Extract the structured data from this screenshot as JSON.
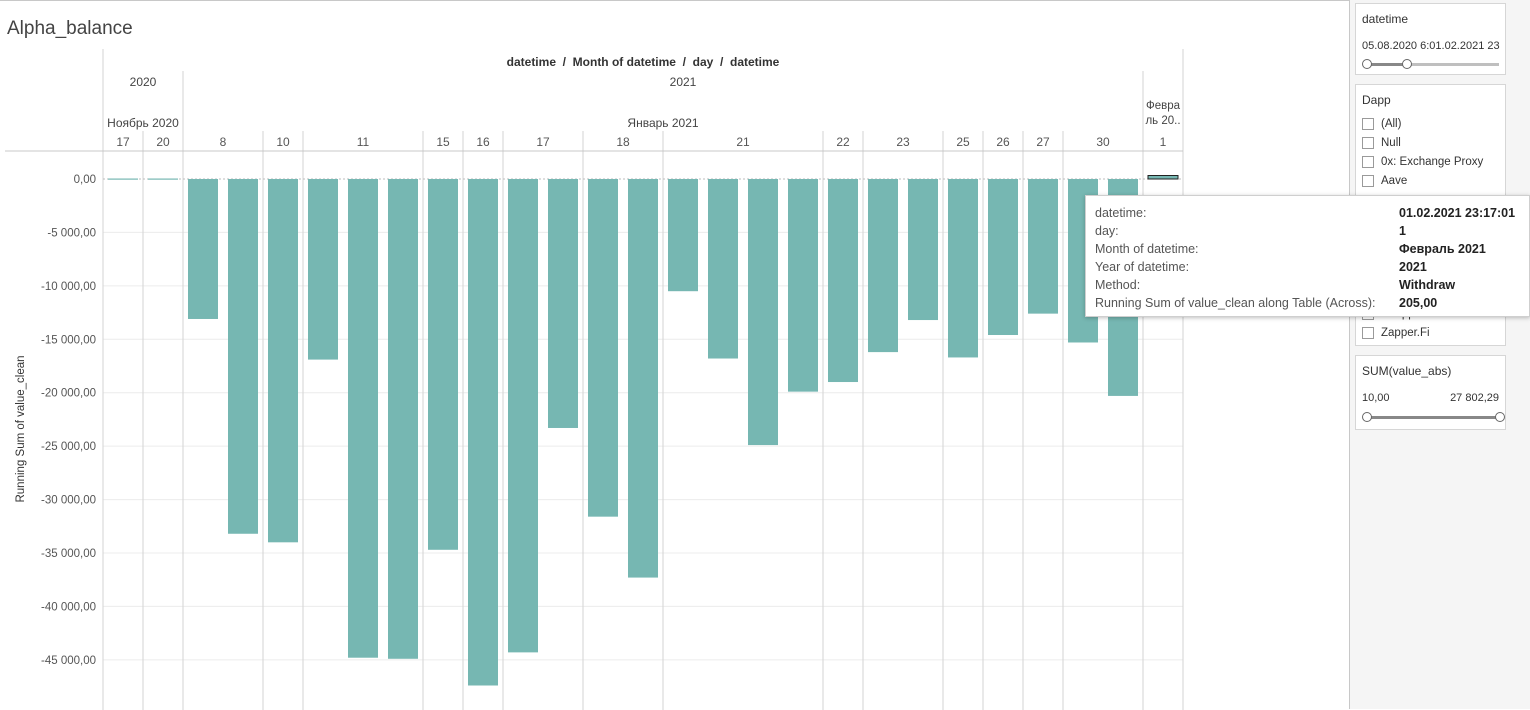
{
  "sheet": {
    "title": "Alpha_balance",
    "column_header": "datetime  /  Month of datetime  /  day  /  datetime",
    "years": [
      "2020",
      "2021"
    ],
    "months": [
      "Ноябрь 2020",
      "Январь 2021",
      "Февра ль 20.."
    ],
    "days": [
      "17",
      "20",
      "8",
      "10",
      "11",
      "15",
      "16",
      "17",
      "18",
      "21",
      "22",
      "23",
      "25",
      "26",
      "27",
      "30",
      "1"
    ],
    "y_axis_label": "Running Sum of value_clean"
  },
  "chart_data": {
    "type": "bar",
    "ylabel": "Running Sum of value_clean",
    "ylim": [
      -49000,
      2000
    ],
    "y_ticks": [
      0,
      -5000,
      -10000,
      -15000,
      -20000,
      -25000,
      -30000,
      -35000,
      -40000,
      -45000
    ],
    "y_tick_labels": [
      "0,00",
      "-5 000,00",
      "-10 000,00",
      "-15 000,00",
      "-20 000,00",
      "-25 000,00",
      "-30 000,00",
      "-35 000,00",
      "-40 000,00",
      "-45 000,00"
    ],
    "bar_color": "#76b7b2",
    "values": [
      -20,
      -20,
      -13100,
      -33200,
      -34000,
      -16900,
      -44800,
      -44900,
      -34700,
      -47400,
      -44300,
      -23300,
      -31600,
      -37300,
      -10500,
      -16800,
      -24900,
      -19900,
      -19000,
      -16200,
      -13200,
      -16700,
      -14600,
      -12600,
      -15300,
      -20300,
      205
    ]
  },
  "tooltip": {
    "rows": [
      {
        "key": "datetime:",
        "value": "01.02.2021 23:17:01"
      },
      {
        "key": "day:",
        "value": "1"
      },
      {
        "key": "Month of datetime:",
        "value": "Февраль 2021"
      },
      {
        "key": "Year of datetime:",
        "value": "2021"
      },
      {
        "key": "Method:",
        "value": "Withdraw"
      },
      {
        "key": "Running Sum of value_clean along Table (Across):",
        "value": "205,00"
      }
    ]
  },
  "filters": {
    "datetime": {
      "title": "datetime",
      "range_text": "05.08.2020 6:01.02.2021 23",
      "low_fraction": 0.0,
      "high_fraction": 0.3
    },
    "dapp": {
      "title": "Dapp",
      "items": [
        "(All)",
        "Null",
        "0x: Exchange Proxy",
        "Aave",
        "Wrapped Ether",
        "Zapper.Fi"
      ]
    },
    "sum_value_abs": {
      "title": "SUM(value_abs)",
      "min": "10,00",
      "max": "27 802,29",
      "low_fraction": 0.0,
      "high_fraction": 1.0
    }
  }
}
